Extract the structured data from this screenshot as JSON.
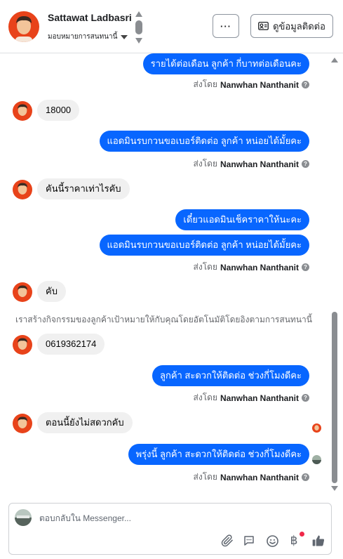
{
  "header": {
    "name": "Sattawat Ladbasri",
    "assign_label": "มอบหมายการสนทนานี้",
    "more_label": "···",
    "contact_label": "ดูข้อมูลติดต่อ"
  },
  "messages": {
    "m1": "รายได้ต่อเดือน  ลูกค้า กี่บาทต่อเดือนคะ",
    "m2": "18000",
    "m3": "แอดมินรบกวนขอเบอร์ติดต่อ ลูกค้า หน่อยได้มั้ยคะ",
    "m4": "คันนี้ราคาเท่าไรคับ",
    "m5": "เดี๋ยวแอดมินเช็คราคาให้นะคะ",
    "m6": "แอดมินรบกวนขอเบอร์ติดต่อ ลูกค้า หน่อยได้มั้ยคะ",
    "m7": "คับ",
    "m8": "0619362174",
    "m9": "ลูกค้า สะดวกให้ติดต่อ ช่วงกี่โมงดีคะ",
    "m10": "ตอนนี้ยังไม่สดวกคับ",
    "m11": "พรุ่งนี้ ลูกค้า สะดวกให้ติดต่อ ช่วงกี่โมงดีคะ"
  },
  "sent_by": {
    "prefix": "ส่งโดย",
    "agent": "Nanwhan Nanthanit"
  },
  "system_note": "เราสร้างกิจกรรมของลูกค้าเป้าหมายให้กับคุณโดยอัตโนมัติโดยอิงตามการสนทนานี้",
  "composer": {
    "placeholder": "ตอบกลับใน Messenger..."
  },
  "icons": {
    "baht": "฿"
  },
  "colors": {
    "outgoing_bubble": "#0866ff",
    "incoming_bubble": "#f0f0f0",
    "notification_dot": "#f02849"
  }
}
